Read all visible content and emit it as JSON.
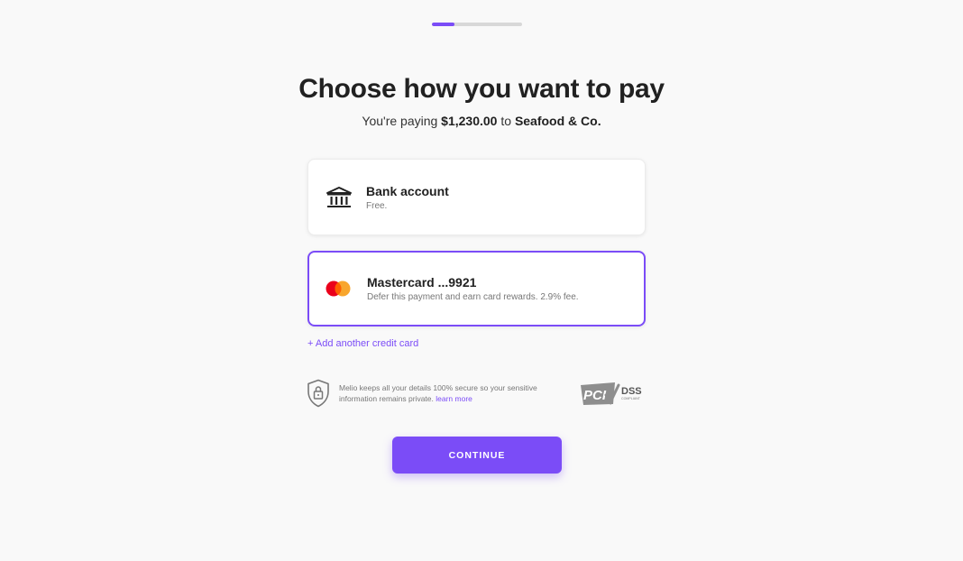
{
  "progress": {
    "percent": 25
  },
  "header": {
    "title": "Choose how you want to pay",
    "subtitle_prefix": "You're paying ",
    "amount": "$1,230.00",
    "subtitle_mid": " to ",
    "payee": "Seafood & Co."
  },
  "methods": [
    {
      "icon": "bank-icon",
      "title": "Bank account",
      "description": "Free.",
      "selected": false
    },
    {
      "icon": "mastercard-icon",
      "title": "Mastercard ...9921",
      "description": "Defer this payment and earn card rewards. 2.9% fee.",
      "selected": true
    }
  ],
  "add_card": {
    "label": "+ Add another credit card"
  },
  "security": {
    "text": "Melio keeps all your details 100% secure so your sensitive information remains private. ",
    "link": "learn more",
    "badge_pci": "PCI",
    "badge_dss": "DSS",
    "badge_compliant": "COMPLIANT"
  },
  "continue": {
    "label": "CONTINUE"
  },
  "colors": {
    "accent": "#7b4cf7",
    "mastercard_red": "#eb001b",
    "mastercard_orange": "#f79e1b"
  }
}
